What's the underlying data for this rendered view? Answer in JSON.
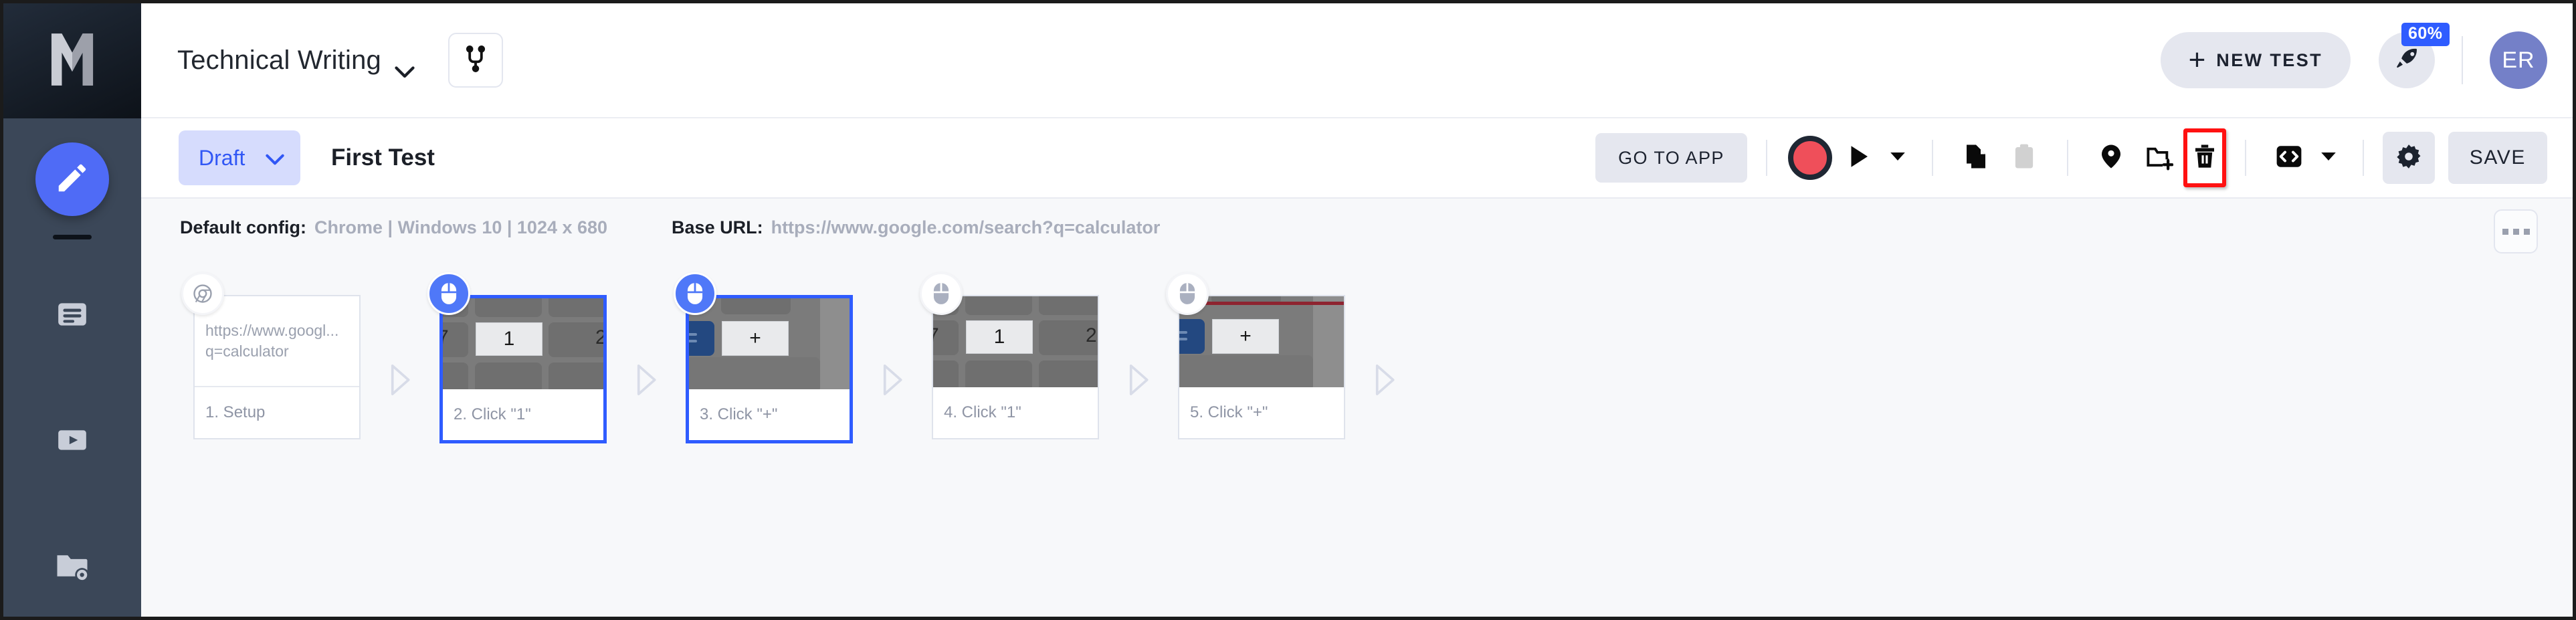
{
  "app": {
    "logo_icon": "endtest-m-logo",
    "brand_color": "#2f5cff"
  },
  "sidebar": {
    "items": [
      {
        "icon": "pencil-icon",
        "name": "editor",
        "active": true
      },
      {
        "icon": "list-icon",
        "name": "test-cases",
        "active": false
      },
      {
        "icon": "play-video-icon",
        "name": "executions",
        "active": false
      },
      {
        "icon": "folder-gear-icon",
        "name": "settings-folder",
        "active": false
      }
    ]
  },
  "header": {
    "project_name": "Technical Writing",
    "project_chevron_icon": "chevron-down-icon",
    "branch_icon": "git-branch-icon",
    "new_test_label": "NEW TEST",
    "new_test_plus": "+",
    "rocket_icon": "rocket-icon",
    "progress_badge": "60%",
    "avatar_initials": "ER"
  },
  "toolbar": {
    "status_label": "Draft",
    "status_chevron_icon": "chevron-down-icon",
    "test_title": "First Test",
    "go_to_app_label": "GO TO APP",
    "icons": [
      {
        "name": "record-button",
        "icon": "record-circle-icon"
      },
      {
        "name": "run-button",
        "icon": "play-icon"
      },
      {
        "name": "run-options-button",
        "icon": "caret-down-icon"
      },
      {
        "name": "copy-button",
        "icon": "copy-files-icon"
      },
      {
        "name": "paste-button",
        "icon": "clipboard-icon",
        "disabled": true
      },
      {
        "name": "tag-button",
        "icon": "tag-icon"
      },
      {
        "name": "new-folder-button",
        "icon": "folder-plus-icon"
      },
      {
        "name": "delete-button",
        "icon": "trash-icon",
        "highlighted": true
      },
      {
        "name": "code-button",
        "icon": "code-brackets-icon"
      },
      {
        "name": "code-options-button",
        "icon": "caret-down-icon"
      },
      {
        "name": "settings-button",
        "icon": "gear-icon"
      }
    ],
    "save_label": "SAVE",
    "highlight_color": "#ff1111"
  },
  "config": {
    "default_config_label": "Default config:",
    "default_config_value": "Chrome | Windows 10 | 1024 x 680",
    "base_url_label": "Base URL:",
    "base_url_value": "https://www.google.com/search?q=calculator",
    "more_menu_icon": "ellipsis-icon"
  },
  "steps": {
    "arrow_icon": "chevron-right-outline-icon",
    "items": [
      {
        "index": "1",
        "label": "1. Setup",
        "thumb_type": "url",
        "url_line1": "https://www.googl...",
        "url_line2": "q=calculator",
        "badge_icon": "chrome-icon",
        "selected": false
      },
      {
        "index": "2",
        "label": "2. Click \"1\"",
        "thumb_type": "calc",
        "key_label": "1",
        "variant": "one",
        "badge_icon": "mouse-icon",
        "selected": true
      },
      {
        "index": "3",
        "label": "3. Click \"+\"",
        "thumb_type": "calc",
        "key_label": "+",
        "variant": "plus",
        "badge_icon": "mouse-icon",
        "selected": true
      },
      {
        "index": "4",
        "label": "4. Click \"1\"",
        "thumb_type": "calc",
        "key_label": "1",
        "variant": "one",
        "badge_icon": "mouse-icon",
        "selected": false
      },
      {
        "index": "5",
        "label": "5. Click \"+\"",
        "thumb_type": "calc",
        "key_label": "+",
        "variant": "plus-red",
        "badge_icon": "mouse-icon",
        "selected": false
      }
    ]
  }
}
